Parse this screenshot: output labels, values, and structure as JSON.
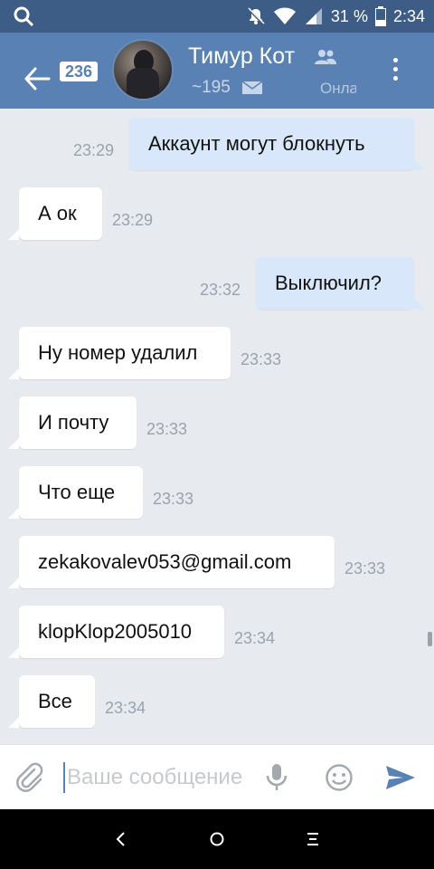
{
  "status_bar": {
    "battery_text": "31 %",
    "time": "2:34",
    "icons": [
      "search-icon",
      "mute-icon",
      "wifi-icon",
      "signal-icon",
      "battery-icon"
    ]
  },
  "header": {
    "unread_count": "236",
    "name": "Тимур Кот",
    "friends_count": "~195",
    "status_text": "Онлайн",
    "accent": "#5981b3"
  },
  "messages": [
    {
      "direction": "out",
      "text": "Аккаунт могут блокнуть",
      "time": "23:29"
    },
    {
      "direction": "in",
      "text": "А ок",
      "time": "23:29"
    },
    {
      "direction": "out",
      "text": "Выключил?",
      "time": "23:32"
    },
    {
      "direction": "in",
      "text": "Ну номер удалил",
      "time": "23:33"
    },
    {
      "direction": "in",
      "text": "И почту",
      "time": "23:33"
    },
    {
      "direction": "in",
      "text": "Что еще",
      "time": "23:33"
    },
    {
      "direction": "in",
      "text": "zekakovalev053@gmail.com",
      "time": "23:33"
    },
    {
      "direction": "in",
      "text": "klopKlop2005010",
      "time": "23:34"
    },
    {
      "direction": "in",
      "text": "Все",
      "time": "23:34"
    }
  ],
  "input": {
    "placeholder": "Ваше сообщение",
    "value": ""
  },
  "colors": {
    "outgoing_bubble": "#d8e7fa",
    "incoming_bubble": "#ffffff",
    "background": "#e7eaef"
  }
}
